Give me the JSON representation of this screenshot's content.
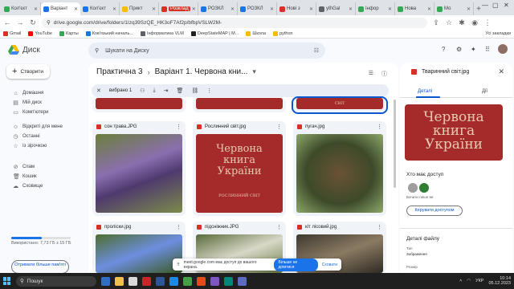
{
  "browser": {
    "tabs": [
      {
        "label": "Кол'єкт",
        "color": "#34a853"
      },
      {
        "label": "Варіант",
        "color": "#1a73e8",
        "active": true
      },
      {
        "label": "Кол'єкт",
        "color": "#1a73e8"
      },
      {
        "label": "Прикт",
        "color": "#fbbc04"
      },
      {
        "label": "Розклад",
        "color": "#d93025",
        "badge": true
      },
      {
        "label": "РОЗКЛ",
        "color": "#1a73e8"
      },
      {
        "label": "РОЗКЛ",
        "color": "#1a73e8"
      },
      {
        "label": "Нові з",
        "color": "#d93025"
      },
      {
        "label": "y8\\Gal",
        "color": "#5f6368"
      },
      {
        "label": "Інфор",
        "color": "#34a853"
      },
      {
        "label": "Нова",
        "color": "#34a853"
      },
      {
        "label": "Мо",
        "color": "#34a853"
      }
    ],
    "url": "drive.google.com/drive/folders/1Izq39SzQE_HK3oF7Af2p/bfbpVSLW2M-",
    "bookmarks": [
      {
        "label": "Gmail",
        "color": "#d93025"
      },
      {
        "label": "YouTube",
        "color": "#ff0000"
      },
      {
        "label": "Карты",
        "color": "#34a853"
      },
      {
        "label": "Ков'язький началь...",
        "color": "#1a73e8"
      },
      {
        "label": "Інформатика VLM",
        "color": "#5f6368"
      },
      {
        "label": "DeepStateMAP | М...",
        "color": "#202124"
      },
      {
        "label": "Школа",
        "color": "#fbbc04"
      },
      {
        "label": "python",
        "color": "#fbbc04"
      }
    ],
    "bookmarks_right": "Усі закладки"
  },
  "drive": {
    "app_name": "Диск",
    "create_label": "Створити",
    "search_placeholder": "Шукати на Диску",
    "nav": [
      {
        "label": "Домашня",
        "icon": "⌂"
      },
      {
        "label": "Мій диск",
        "icon": "▤"
      },
      {
        "label": "Комп'ютери",
        "icon": "▭"
      },
      {
        "label": "Відкриті для мене",
        "icon": "☺"
      },
      {
        "label": "Останні",
        "icon": "◷"
      },
      {
        "label": "Із зірочкою",
        "icon": "☆"
      },
      {
        "label": "Спам",
        "icon": "⊘"
      },
      {
        "label": "Кошик",
        "icon": "🗑"
      },
      {
        "label": "Сховище",
        "icon": "☁"
      }
    ],
    "storage_text": "Використано: 7,73 ГБ з 15 ГБ",
    "storage_used_fraction": 0.515,
    "get_more_label": "Отримати більше пам'яті",
    "breadcrumb": [
      "Практична 3",
      "Варіант 1. Червона кни..."
    ],
    "selected_label": "вибрано 1",
    "files": [
      {
        "name": "сон трава.JPG"
      },
      {
        "name": "Рослинний світ.jpg"
      },
      {
        "name": "пугач.jpg"
      },
      {
        "name": "проліски.jpg"
      },
      {
        "name": "підсніжник.JPG"
      },
      {
        "name": "кіт лісовий.jpg"
      }
    ],
    "book_text": [
      "Червона",
      "книга",
      "України"
    ],
    "book_subtitle_plants": "РОСЛИННИЙ СВІТ",
    "book_subtitle_animals": "СВІТ"
  },
  "details": {
    "title": "Тваринний світ.jpg",
    "tabs": [
      "Деталі",
      "Дії"
    ],
    "access_heading": "Хто має доступ",
    "access_note": "Бачити лише ви",
    "manage_label": "Керувати доступом",
    "file_details_heading": "Деталі файлу",
    "type_label": "Тип",
    "type_value": "Зображення",
    "size_label": "Розмір"
  },
  "popup": {
    "text": "meet.google.com має доступ до вашого екрана.",
    "stop_label": "Більше не ділитися",
    "hide_label": "Сховати"
  },
  "taskbar": {
    "search_label": "Пошук",
    "lang": "УКР",
    "time": "10:14",
    "date": "05.12.2023"
  }
}
